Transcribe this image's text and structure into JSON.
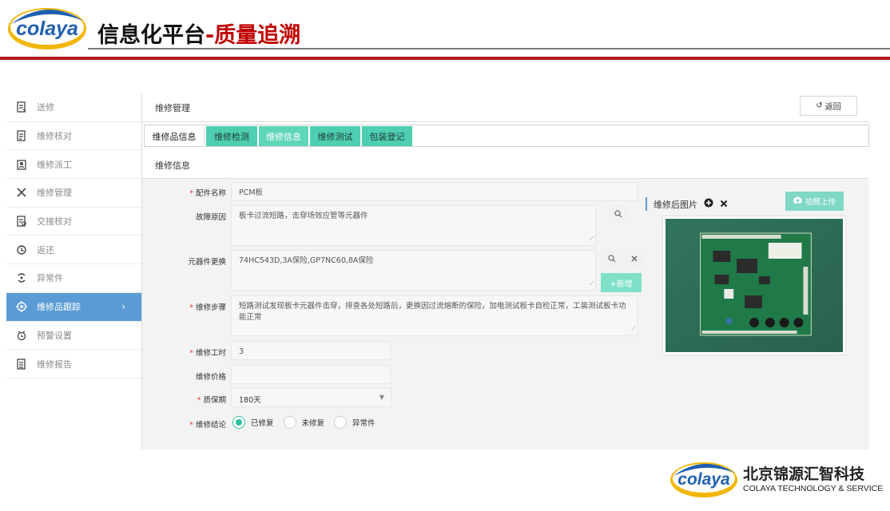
{
  "header": {
    "logo_text": "colaya",
    "title_main": "信息化平台",
    "title_accent": "-质量追溯"
  },
  "sidebar": {
    "items": [
      {
        "label": "送修",
        "icon": "repair-send-icon",
        "active": false
      },
      {
        "label": "维修核对",
        "icon": "checklist-icon",
        "active": false
      },
      {
        "label": "维修派工",
        "icon": "dispatch-icon",
        "active": false
      },
      {
        "label": "维修管理",
        "icon": "tools-icon",
        "active": false
      },
      {
        "label": "交接核对",
        "icon": "handover-icon",
        "active": false
      },
      {
        "label": "返还",
        "icon": "return-icon",
        "active": false
      },
      {
        "label": "异常件",
        "icon": "exception-icon",
        "active": false
      },
      {
        "label": "维修品跟踪",
        "icon": "tracking-icon",
        "active": true
      },
      {
        "label": "预警设置",
        "icon": "alarm-icon",
        "active": false
      },
      {
        "label": "维修报告",
        "icon": "report-icon",
        "active": false
      }
    ],
    "active_chevron": "›"
  },
  "main": {
    "title": "维修管理",
    "back_label": "返回",
    "back_icon": "↺",
    "tabs": [
      {
        "label": "维修品信息"
      },
      {
        "label": "维修检测"
      },
      {
        "label": "维修信息"
      },
      {
        "label": "维修测试"
      },
      {
        "label": "包装登记"
      }
    ],
    "section_title": "维修信息"
  },
  "form": {
    "part_name": {
      "label": "配件名称",
      "value": "PCM板"
    },
    "fault_reason": {
      "label": "故障原因",
      "value": "板卡过流短路，击穿场效应管等元器件"
    },
    "component_replace": {
      "label": "元器件更换",
      "value": "74HC543D,3A保险,GP7NC60,8A保险",
      "add_label": "+新增"
    },
    "repair_steps": {
      "label": "维修步骤",
      "value": "短路测试发现板卡元器件击穿，排查各处短路后，更换因过流熔断的保险，加电测试板卡自检正常，工装测试板卡功能正常"
    },
    "repair_hours": {
      "label": "维修工时",
      "value": "3"
    },
    "repair_price": {
      "label": "维修价格",
      "value": ""
    },
    "warranty": {
      "label": "质保期",
      "value": "180天"
    },
    "conclusion": {
      "label": "维修结论",
      "options": [
        {
          "label": "已修复",
          "selected": true
        },
        {
          "label": "未修复",
          "selected": false
        },
        {
          "label": "异常件",
          "selected": false
        }
      ]
    }
  },
  "photo": {
    "title": "维修后图片",
    "upload_label": "拍照上传"
  },
  "footer": {
    "logo_text": "colaya",
    "company_cn": "北京锦源汇智科技",
    "company_en": "COLAYA TECHNOLOGY & SERVICE"
  },
  "colors": {
    "brand_red": "#c00000",
    "brand_blue": "#1f5fb0",
    "brand_yellow": "#f2b705",
    "sidebar_active": "#5b9bd5",
    "tab_teal": "#4ecfb1",
    "radio_teal": "#2fbf9f"
  }
}
